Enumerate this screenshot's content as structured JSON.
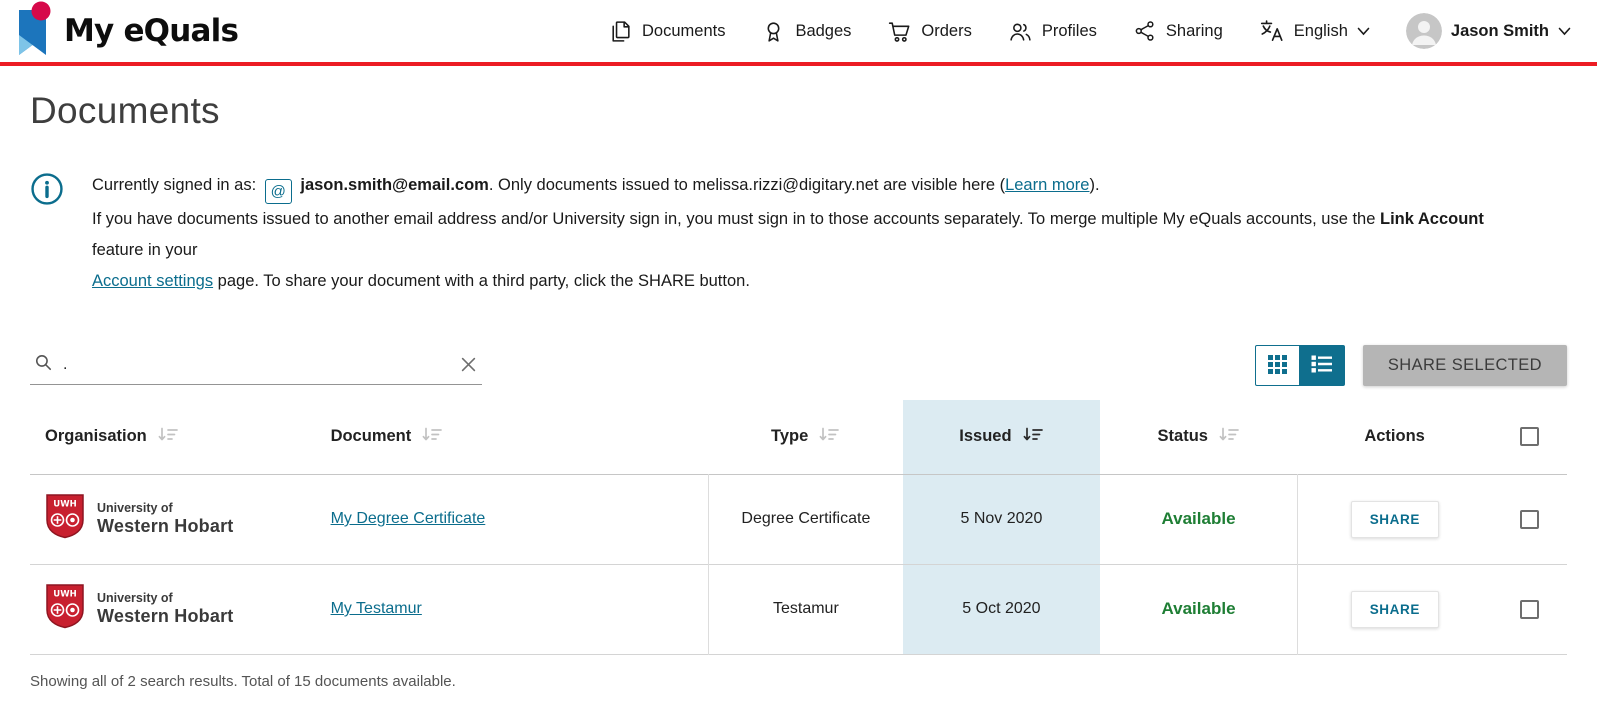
{
  "colors": {
    "brand_red": "#ec1c24",
    "teal_accent": "#0b6d8d",
    "available_green": "#1e7e34",
    "issued_column_highlight": "#dcebf2",
    "active_toggle_bg": "#0f6f8e"
  },
  "header": {
    "brand": "My eQuals",
    "nav": [
      {
        "label": "Documents"
      },
      {
        "label": "Badges"
      },
      {
        "label": "Orders"
      },
      {
        "label": "Profiles"
      },
      {
        "label": "Sharing"
      }
    ],
    "language": {
      "label": "English"
    },
    "user": {
      "name": "Jason Smith"
    }
  },
  "page": {
    "title": "Documents"
  },
  "info": {
    "signed_in_prefix": "Currently signed in as:",
    "at_symbol": "@",
    "email": "jason.smith@email.com",
    "after_email": ". Only documents issued to melissa.rizzi@digitary.net are visible here (",
    "learn_more": "Learn more",
    "after_learn_more": ").",
    "line2": "If you have documents issued to another email address and/or University sign in, you must sign in to those accounts separately. To merge multiple My eQuals accounts, use the",
    "link_account": "Link Account",
    "line2_end": "feature in your",
    "account_settings": "Account settings",
    "line3_end": "page. To share your document with a third party, click the SHARE button."
  },
  "toolbar": {
    "search_value": ".",
    "share_selected_label": "SHARE SELECTED"
  },
  "table": {
    "headers": {
      "organisation": "Organisation",
      "document": "Document",
      "type": "Type",
      "issued": "Issued",
      "status": "Status",
      "actions": "Actions"
    },
    "rows": [
      {
        "org_abbr": "UWH",
        "org_line1": "University of",
        "org_line2": "Western Hobart",
        "document": "My Degree Certificate",
        "type": "Degree Certificate",
        "issued": "5 Nov 2020",
        "status": "Available",
        "action": "SHARE"
      },
      {
        "org_abbr": "UWH",
        "org_line1": "University of",
        "org_line2": "Western Hobart",
        "document": "My Testamur",
        "type": "Testamur",
        "issued": "5 Oct 2020",
        "status": "Available",
        "action": "SHARE"
      }
    ]
  },
  "footer": {
    "summary": "Showing all of 2 search results. Total of 15 documents available."
  }
}
